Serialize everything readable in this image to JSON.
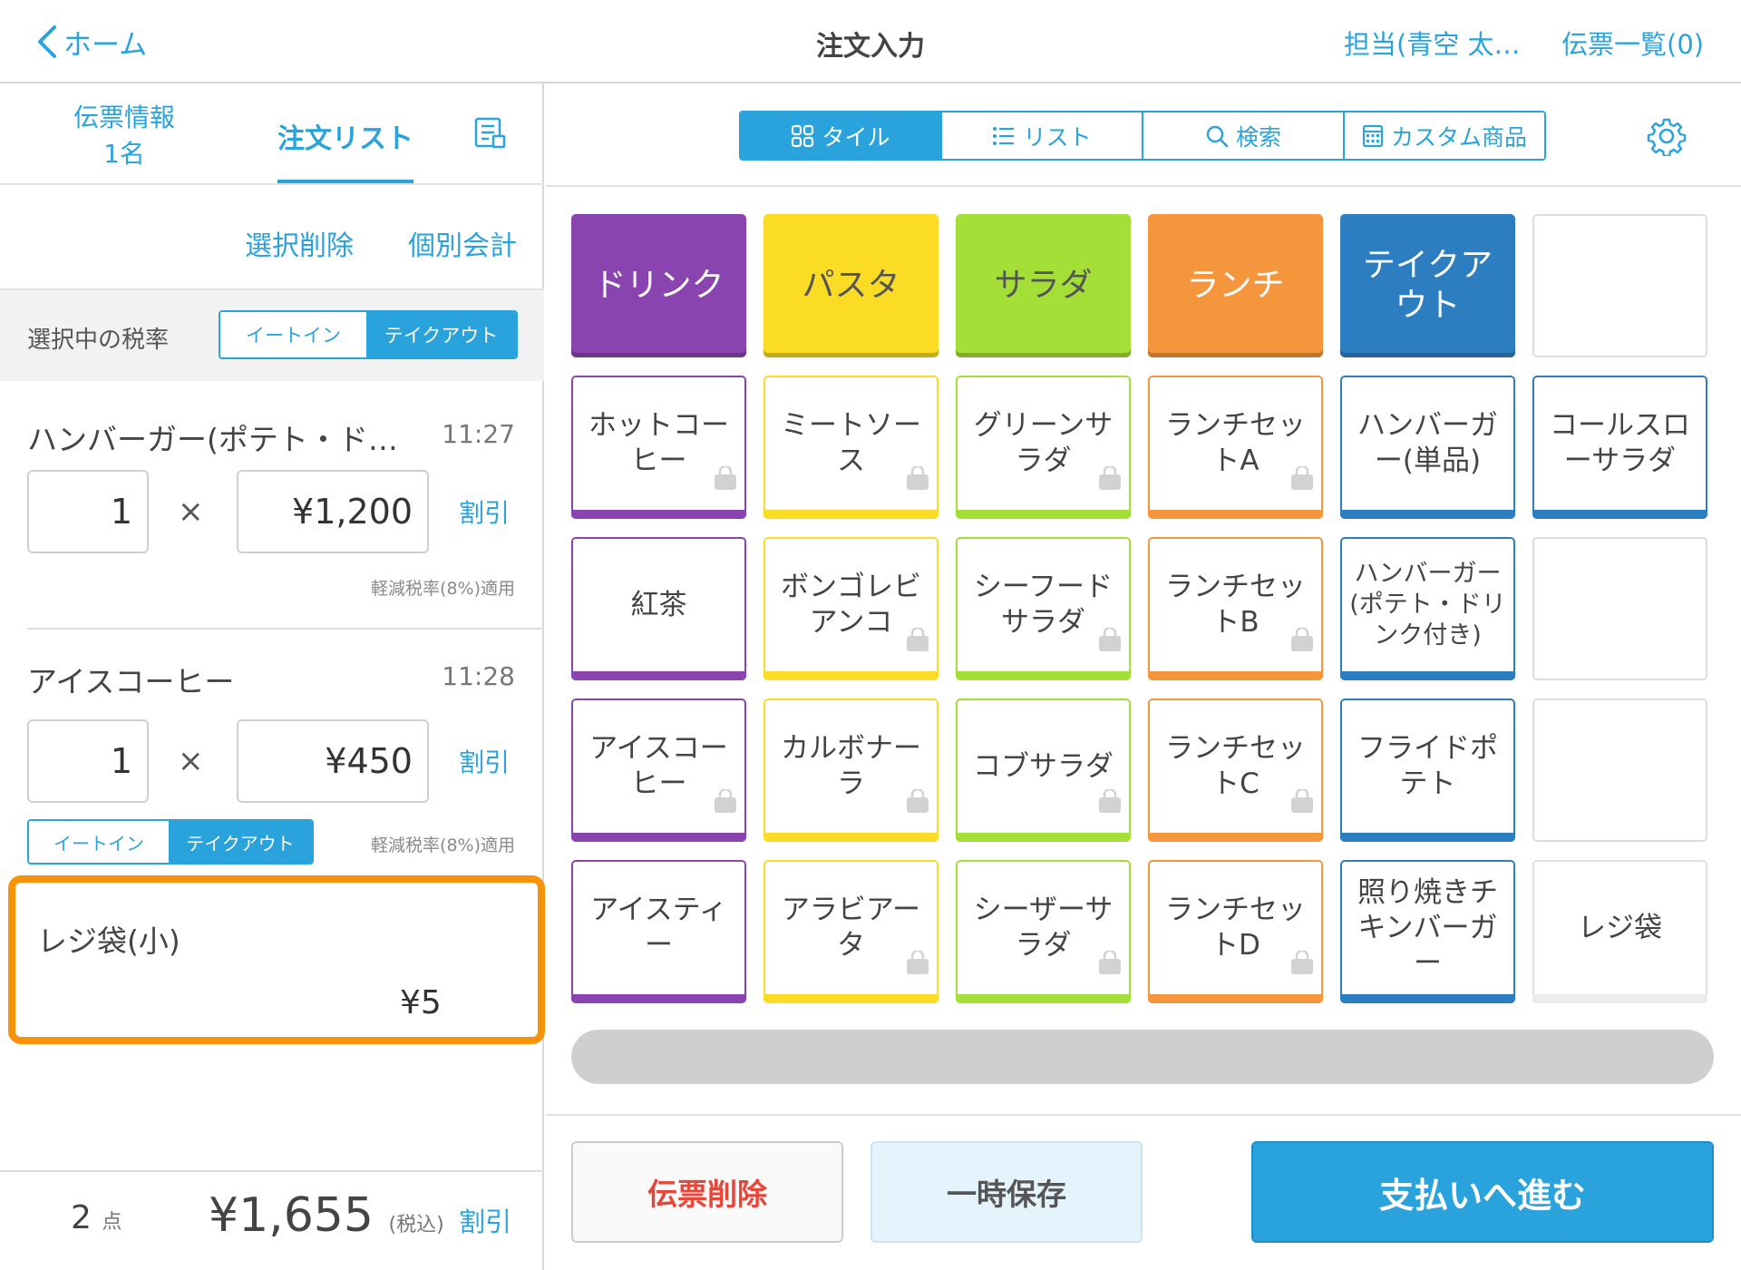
{
  "header": {
    "back_label": "ホーム",
    "title": "注文入力",
    "staff": "担当(青空 太…",
    "slip_list": "伝票一覧(0)"
  },
  "left": {
    "tab_info_line1": "伝票情報",
    "tab_info_line2": "1名",
    "tab_order_list": "注文リスト",
    "select_delete": "選択削除",
    "separate_payment": "個別会計",
    "tax_label": "選択中の税率",
    "eat_in": "イートイン",
    "takeout": "テイクアウト",
    "items": [
      {
        "name": "ハンバーガー(ポテト・ド…",
        "time": "11:27",
        "qty": "1",
        "price": "¥1,200",
        "discount": "割引",
        "tax_note": "軽減税率(8%)適用"
      },
      {
        "name": "アイスコーヒー",
        "time": "11:28",
        "qty": "1",
        "price": "¥450",
        "discount": "割引",
        "eat_in": "イートイン",
        "takeout": "テイクアウト",
        "tax_note": "軽減税率(8%)適用"
      }
    ],
    "bag": {
      "name": "レジ袋(小)",
      "price": "¥5"
    },
    "footer": {
      "count": "2",
      "count_unit": "点",
      "total": "¥1,655",
      "tax_incl": "(税込)",
      "discount": "割引"
    }
  },
  "right": {
    "view_tabs": {
      "tile": "タイル",
      "list": "リスト",
      "search": "検索",
      "custom": "カスタム商品"
    },
    "categories": [
      {
        "label": "ドリンク",
        "color": "#8a44b0"
      },
      {
        "label": "パスタ",
        "color": "#fadc25"
      },
      {
        "label": "サラダ",
        "color": "#a4df37"
      },
      {
        "label": "ランチ",
        "color": "#f5963c"
      },
      {
        "label": "テイクアウト",
        "color": "#2d7ec0"
      }
    ],
    "products": {
      "r1c1": "ホットコーヒー",
      "r1c2": "ミートソース",
      "r1c3": "グリーンサラダ",
      "r1c4": "ランチセットA",
      "r1c5": "ハンバーガー(単品)",
      "r1c6": "コールスローサラダ",
      "r2c1": "紅茶",
      "r2c2": "ボンゴレビアンコ",
      "r2c3": "シーフードサラダ",
      "r2c4": "ランチセットB",
      "r2c5": "ハンバーガー(ポテト・ドリンク付き)",
      "r3c1": "アイスコーヒー",
      "r3c2": "カルボナーラ",
      "r3c3": "コブサラダ",
      "r3c4": "ランチセットC",
      "r3c5": "フライドポテト",
      "r4c1": "アイスティー",
      "r4c2": "アラビアータ",
      "r4c3": "シーザーサラダ",
      "r4c4": "ランチセットD",
      "r4c5": "照り焼きチキンバーガー",
      "r4c6": "レジ袋"
    },
    "buttons": {
      "delete_slip": "伝票削除",
      "hold": "一時保存",
      "pay": "支払いへ進む"
    },
    "colors": {
      "accent": "#2aa3dd",
      "drink": "#8a44b0",
      "pasta": "#fadc25",
      "salad": "#a4df37",
      "lunch": "#f5963c",
      "takeout": "#2d7ec0",
      "highlight": "#f7930a",
      "delete": "#e9463a"
    }
  }
}
